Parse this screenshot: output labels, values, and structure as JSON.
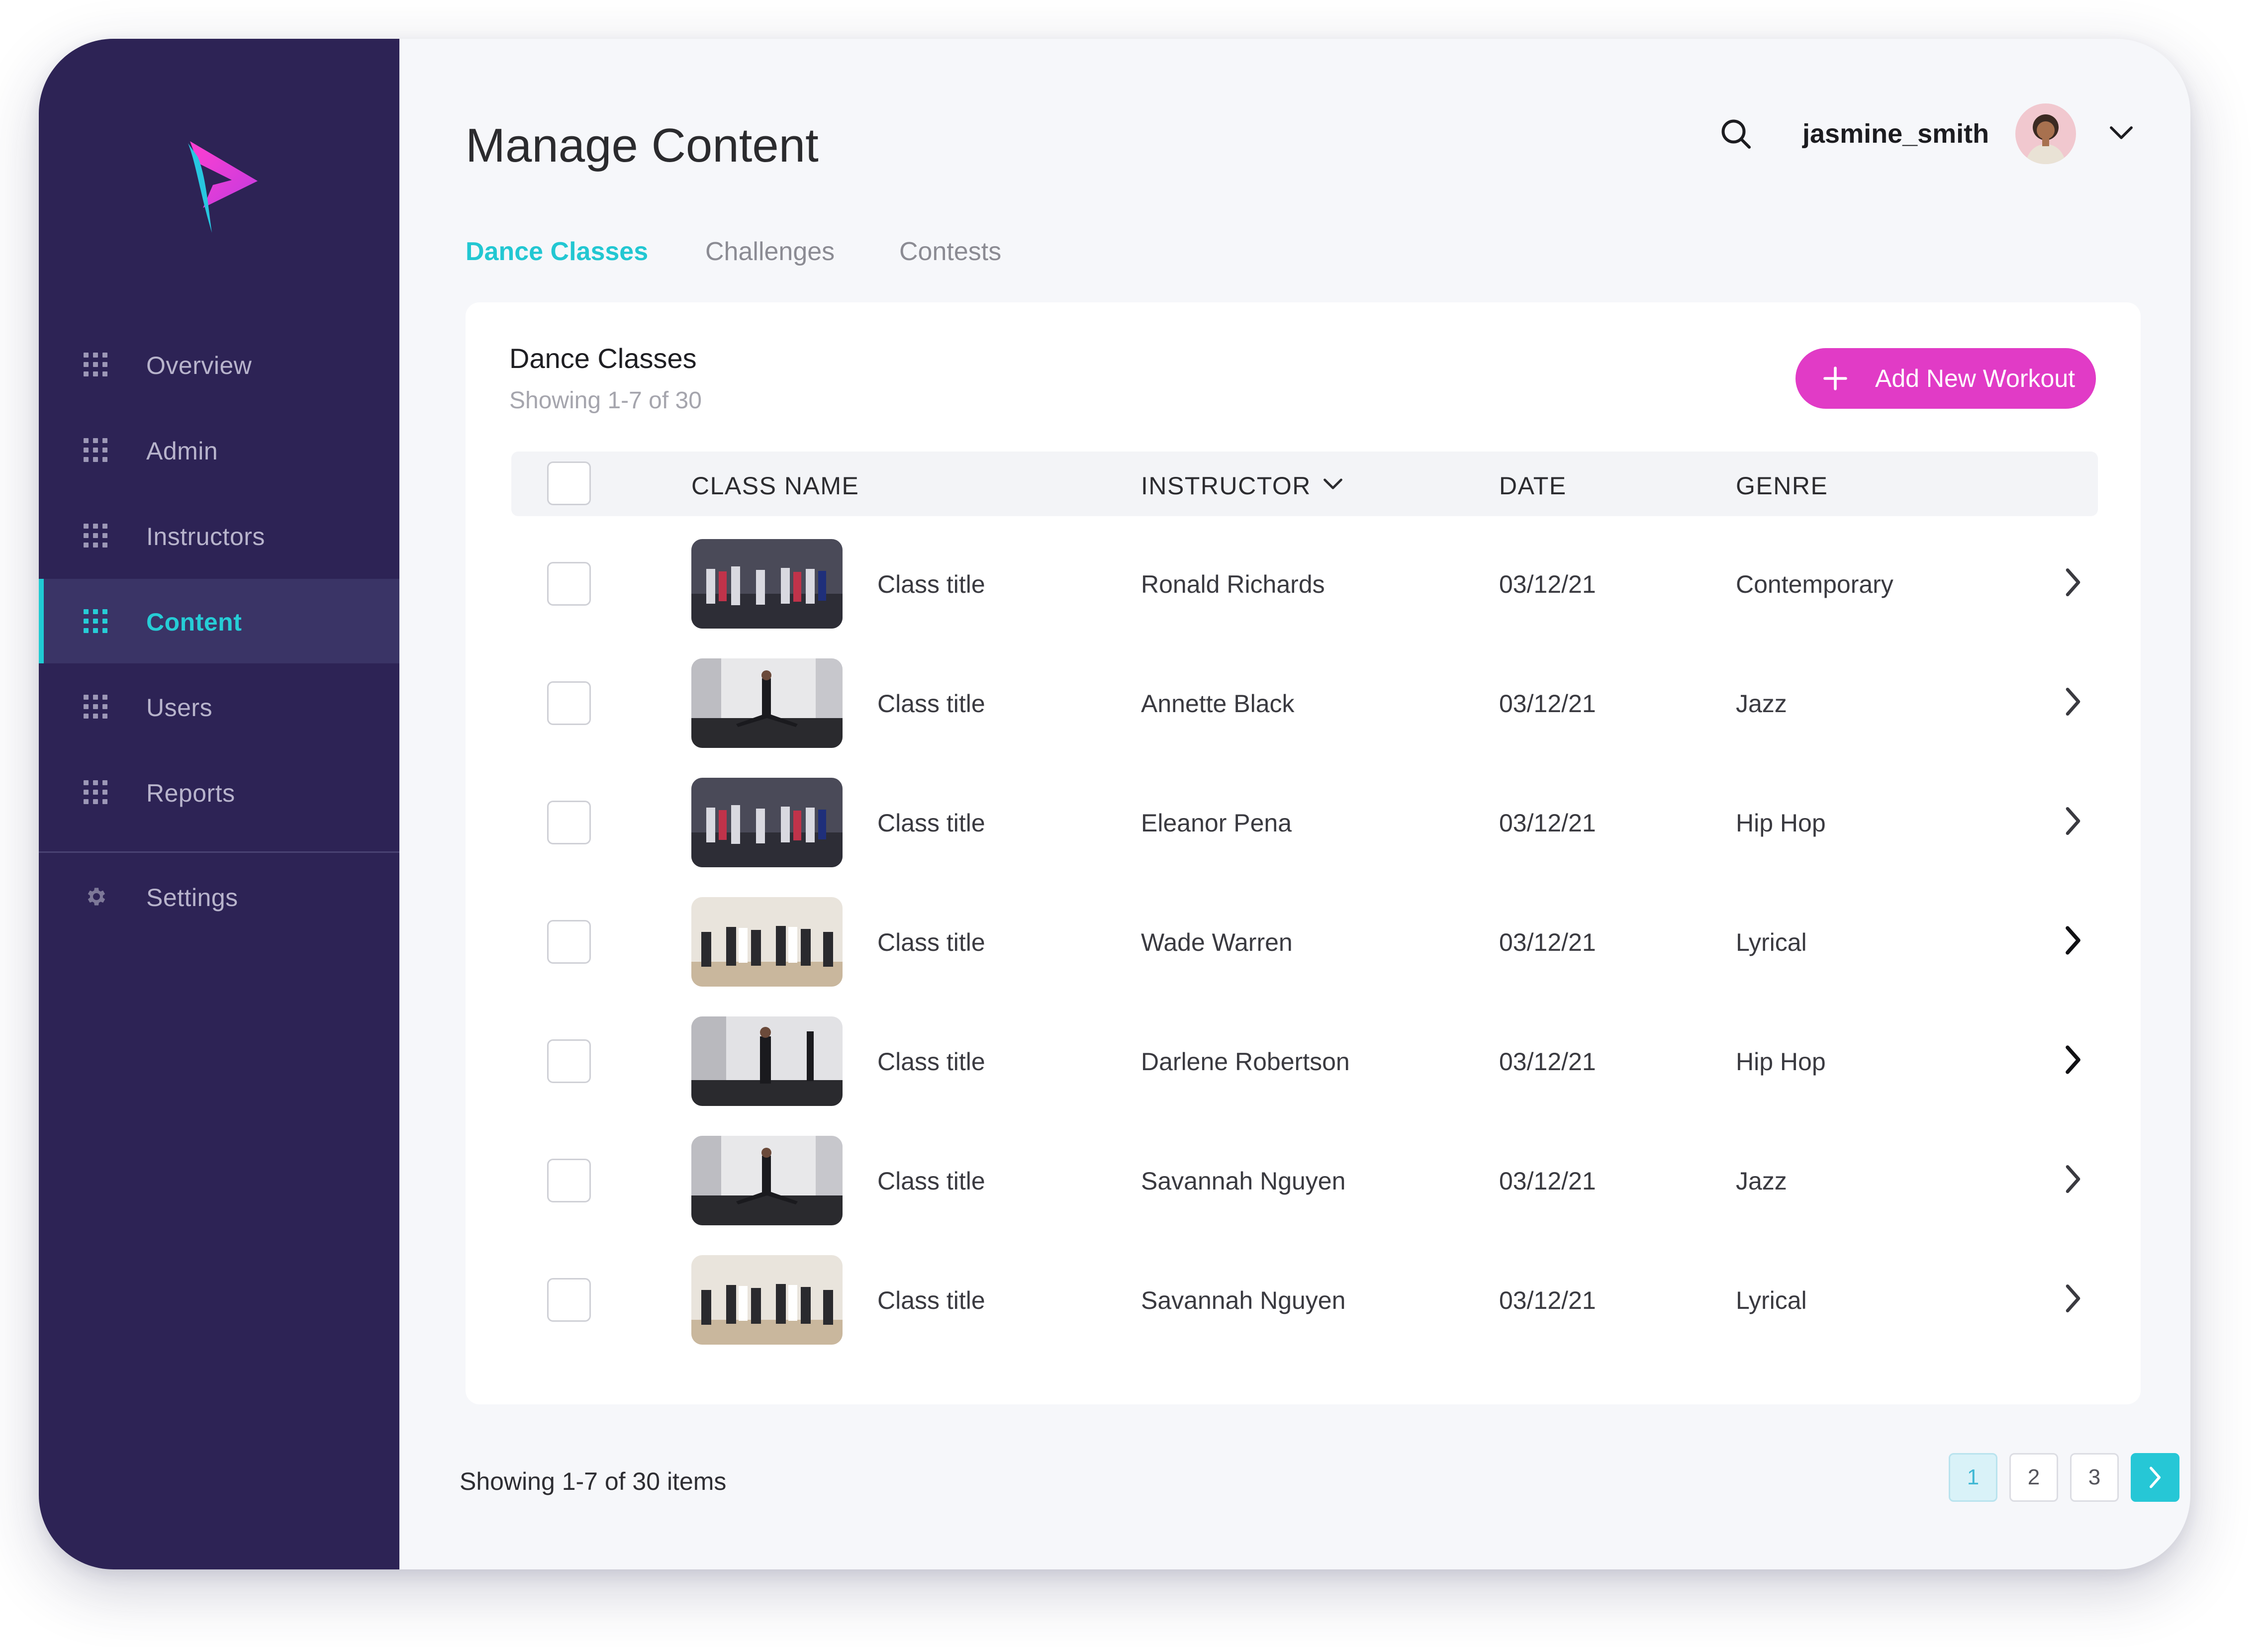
{
  "sidebar": {
    "items": [
      {
        "label": "Overview"
      },
      {
        "label": "Admin"
      },
      {
        "label": "Instructors"
      },
      {
        "label": "Content",
        "active": true
      },
      {
        "label": "Users"
      },
      {
        "label": "Reports"
      }
    ],
    "settings_label": "Settings"
  },
  "header": {
    "title": "Manage Content",
    "username": "jasmine_smith"
  },
  "tabs": [
    {
      "label": "Dance Classes",
      "active": true
    },
    {
      "label": "Challenges"
    },
    {
      "label": "Contests"
    }
  ],
  "card": {
    "title": "Dance Classes",
    "subtitle": "Showing 1-7 of 30",
    "add_button": "Add New Workout"
  },
  "table": {
    "columns": {
      "class_name": "CLASS NAME",
      "instructor": "INSTRUCTOR",
      "date": "DATE",
      "genre": "GENRE"
    },
    "rows": [
      {
        "title": "Class title",
        "instructor": "Ronald Richards",
        "date": "03/12/21",
        "genre": "Contemporary"
      },
      {
        "title": "Class title",
        "instructor": "Annette Black",
        "date": "03/12/21",
        "genre": "Jazz"
      },
      {
        "title": "Class title",
        "instructor": "Eleanor Pena",
        "date": "03/12/21",
        "genre": "Hip Hop"
      },
      {
        "title": "Class title",
        "instructor": "Wade Warren",
        "date": "03/12/21",
        "genre": "Lyrical"
      },
      {
        "title": "Class title",
        "instructor": "Darlene Robertson",
        "date": "03/12/21",
        "genre": "Hip Hop"
      },
      {
        "title": "Class title",
        "instructor": "Savannah Nguyen",
        "date": "03/12/21",
        "genre": "Jazz"
      },
      {
        "title": "Class title",
        "instructor": "Savannah Nguyen",
        "date": "03/12/21",
        "genre": "Lyrical"
      }
    ]
  },
  "footer": {
    "showing": "Showing 1-7 of 30 items",
    "pages": [
      "1",
      "2",
      "3"
    ],
    "current_page": "1"
  },
  "colors": {
    "sidebar_bg": "#2d2355",
    "accent_teal": "#22c7d2",
    "accent_magenta": "#e13bc6"
  },
  "icons": {
    "nav": "grid-dots-icon",
    "settings": "gear-icon",
    "search": "search-icon",
    "user_menu": "chevron-down-icon",
    "add": "plus-icon",
    "row_action": "chevron-right-icon",
    "next_page": "chevron-right-icon"
  }
}
